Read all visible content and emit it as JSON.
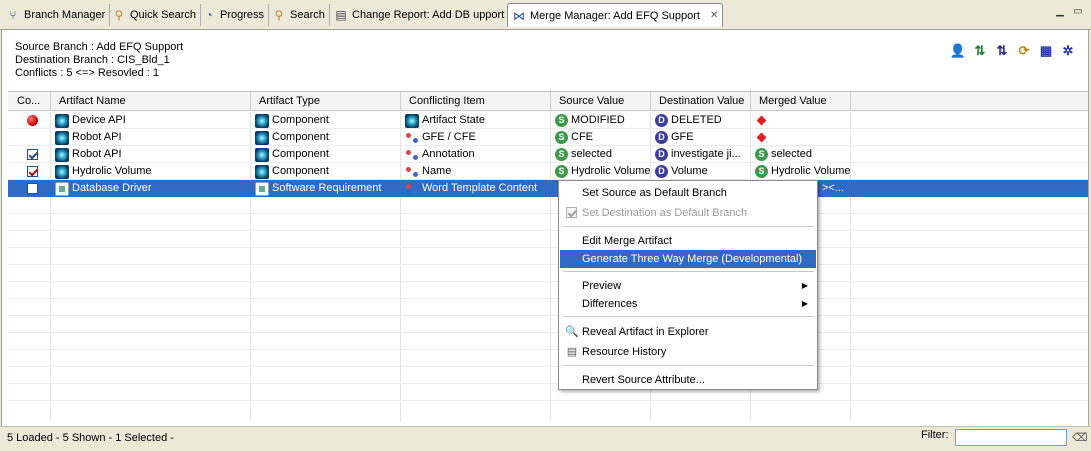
{
  "tabs": [
    {
      "label": "Branch Manager",
      "icon": "branch-icon"
    },
    {
      "label": "Quick Search",
      "icon": "search-icon"
    },
    {
      "label": "Progress",
      "icon": "progress-icon"
    },
    {
      "label": "Search",
      "icon": "search-icon"
    },
    {
      "label": "Change Report: Add DB upport",
      "icon": "report-icon"
    },
    {
      "label": "Merge Manager: Add EFQ Support",
      "icon": "merge-icon",
      "active": true
    }
  ],
  "info": {
    "source_branch": "Source Branch :  Add EFQ Support",
    "destination_branch": "Destination Branch :  CIS_Bld_1",
    "conflicts": "Conflicts : 5 <=> Resovled : 1"
  },
  "toolbar": [
    "user-icon",
    "source-icon",
    "destination-icon",
    "refresh-icon",
    "calculator-icon",
    "bug-icon"
  ],
  "table": {
    "columns": [
      "Co...",
      "Artifact Name",
      "Artifact Type",
      "Conflicting Item",
      "Source Value",
      "Destination Value",
      "Merged Value"
    ],
    "rows": [
      {
        "status": "conflict",
        "name": "Device API",
        "type": "Component",
        "item": "Artifact State",
        "source": "MODIFIED",
        "destination": "DELETED",
        "merged": ""
      },
      {
        "status": "none",
        "name": "Robot API",
        "type": "Component",
        "item": "GFE / CFE",
        "source": "CFE",
        "destination": "GFE",
        "merged": ""
      },
      {
        "status": "checked",
        "name": "Robot API",
        "type": "Component",
        "item": "Annotation",
        "source": "selected",
        "destination": "investigate ji...",
        "merged": "selected"
      },
      {
        "status": "checked-red",
        "name": "Hydrolic Volume",
        "type": "Component",
        "item": "Name",
        "source": "Hydrolic Volume",
        "destination": "Volume",
        "merged": "Hydrolic Volume"
      },
      {
        "status": "unchecked",
        "name": "Database Driver",
        "type": "Software Requirement",
        "item": "Word Template Content",
        "source": "",
        "destination": "",
        "merged": "><..."
      }
    ]
  },
  "context_menu": {
    "items": [
      {
        "label": "Set Source as Default Branch"
      },
      {
        "label": "Set Destination as Default Branch",
        "disabled": true
      },
      {
        "label": "Edit Merge Artifact"
      },
      {
        "label": "Generate Three Way Merge (Developmental)",
        "highlighted": true
      },
      {
        "label": "Preview",
        "submenu": true
      },
      {
        "label": "Differences",
        "submenu": true
      },
      {
        "label": "Reveal Artifact in Explorer",
        "icon": "magnifier-icon"
      },
      {
        "label": "Resource History",
        "icon": "document-icon"
      },
      {
        "label": "Revert Source Attribute..."
      }
    ]
  },
  "status": {
    "text": "5 Loaded - 5 Shown - 1 Selected -",
    "filter_label": "Filter:",
    "filter_value": ""
  },
  "colors": {
    "selection": "#316ac5",
    "source_badge": "#3a9a4a",
    "destination_badge": "#3d3d9e",
    "conflict": "#e02020"
  }
}
